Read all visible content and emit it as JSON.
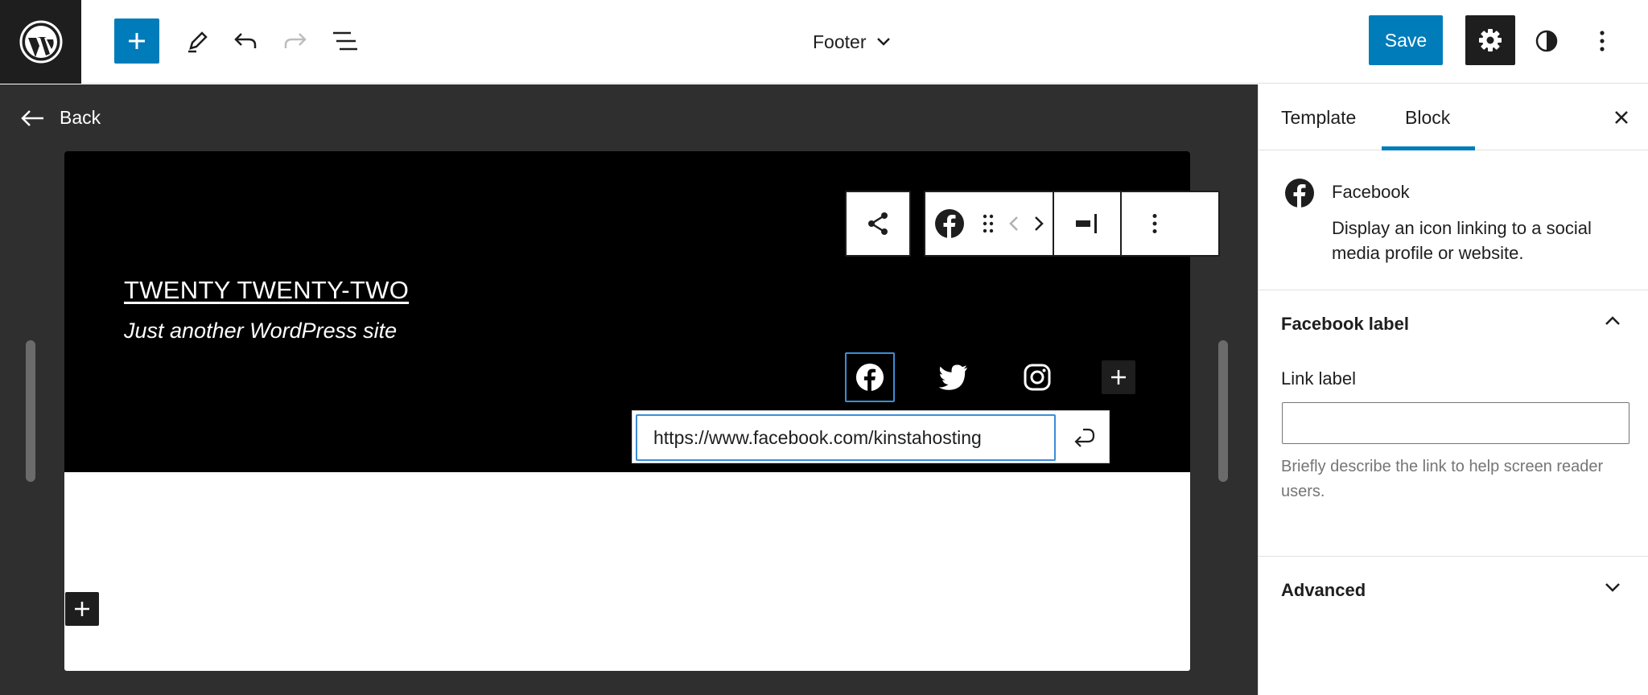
{
  "header": {
    "document_title": "Footer",
    "save_label": "Save"
  },
  "canvas": {
    "back_label": "Back",
    "site_title": "TWENTY TWENTY-TWO",
    "site_tagline": "Just another WordPress site",
    "url_value": "https://www.facebook.com/kinstahosting",
    "social_icons": [
      "facebook-icon",
      "twitter-icon",
      "instagram-icon"
    ]
  },
  "sidebar": {
    "tabs": [
      {
        "label": "Template",
        "active": false
      },
      {
        "label": "Block",
        "active": true
      }
    ],
    "block": {
      "name": "Facebook",
      "description": "Display an icon linking to a social media profile or website."
    },
    "label_panel": {
      "title": "Facebook label",
      "field_label": "Link label",
      "field_value": "",
      "help": "Briefly describe the link to help screen reader users."
    },
    "advanced_panel": {
      "title": "Advanced"
    }
  },
  "colors": {
    "accent": "#007cba",
    "dark": "#1e1e1e",
    "canvas_bg": "#2f2f2f",
    "focus": "#3c8dd8"
  }
}
